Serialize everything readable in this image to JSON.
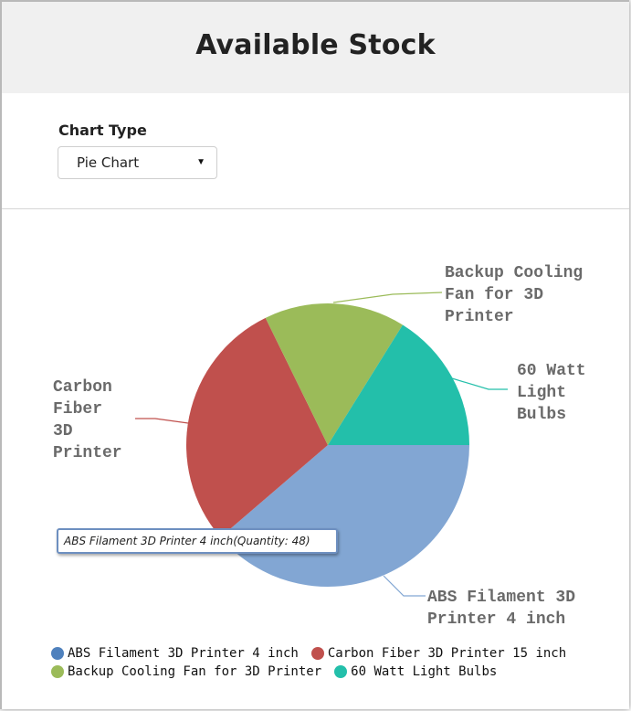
{
  "header": {
    "title": "Available Stock"
  },
  "controls": {
    "chart_type_label": "Chart Type",
    "chart_type_value": "Pie Chart"
  },
  "tooltip": {
    "text": "ABS Filament 3D Printer 4 inch(Quantity: 48)"
  },
  "chart_data": {
    "type": "pie",
    "title": "",
    "categories": [
      "ABS Filament 3D Printer 4 inch",
      "Carbon Fiber 3D Printer 15 inch",
      "Backup Cooling Fan for 3D Printer",
      "60 Watt Light Bulbs"
    ],
    "values": [
      48,
      36,
      20,
      20
    ],
    "colors": [
      "#82a6d3",
      "#c0504d",
      "#9bbb59",
      "#23bfaa"
    ],
    "slice_labels": [
      [
        "ABS Filament 3D",
        "Printer 4 inch"
      ],
      [
        "Carbon",
        "Fiber",
        "3D",
        "Printer"
      ],
      [
        "Backup Cooling",
        "Fan for 3D",
        "Printer"
      ],
      [
        "60 Watt",
        "Light",
        "Bulbs"
      ]
    ],
    "legend": {
      "position": "bottom",
      "marker_colors": [
        "#4f81bd",
        "#c0504d",
        "#9bbb59",
        "#23bfaa"
      ]
    }
  }
}
